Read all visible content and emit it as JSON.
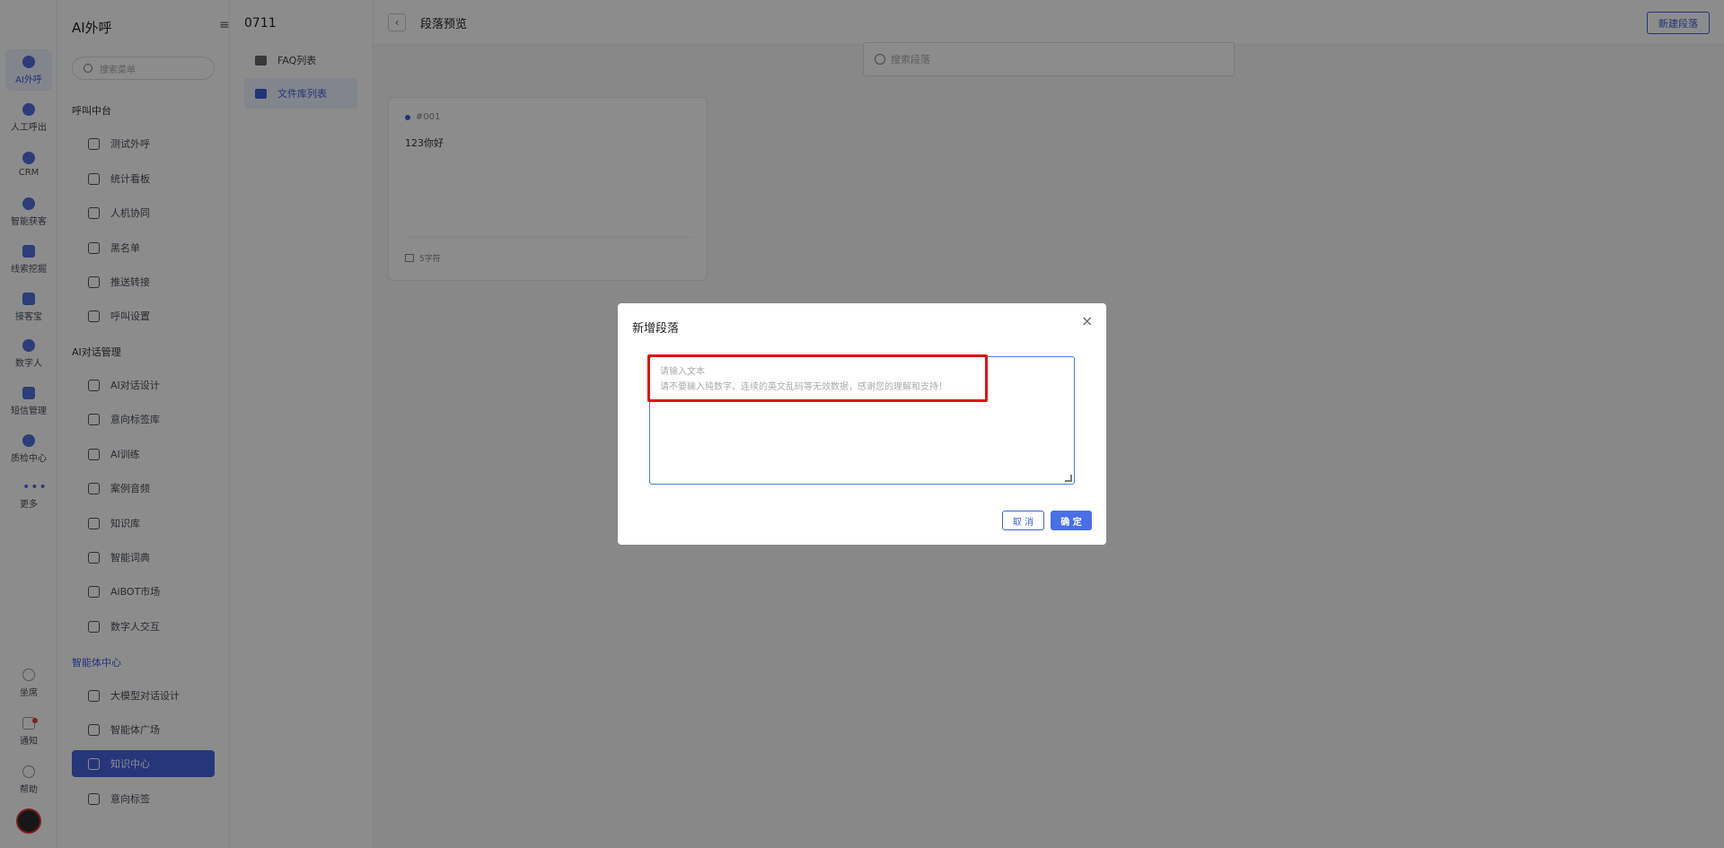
{
  "rail": {
    "items": [
      {
        "label": "AI外呼",
        "icon": "phone-ai-icon"
      },
      {
        "label": "人工呼出",
        "icon": "headset-icon"
      },
      {
        "label": "CRM",
        "icon": "crm-icon"
      },
      {
        "label": "智能获客",
        "icon": "acquire-icon"
      },
      {
        "label": "线索挖掘",
        "icon": "clue-icon"
      },
      {
        "label": "接客宝",
        "icon": "reception-icon"
      },
      {
        "label": "数字人",
        "icon": "digital-human-icon"
      },
      {
        "label": "短信管理",
        "icon": "sms-icon"
      },
      {
        "label": "质检中心",
        "icon": "quality-icon"
      },
      {
        "label": "更多",
        "icon": "more-icon"
      }
    ],
    "bottom": [
      {
        "label": "坐席",
        "icon": "seat-icon"
      },
      {
        "label": "通知",
        "icon": "bell-icon"
      },
      {
        "label": "帮助",
        "icon": "help-icon"
      }
    ]
  },
  "menu": {
    "title": "AI外呼",
    "collapse_icon": "≡",
    "search_placeholder": "搜索菜单",
    "groups": [
      {
        "label": "呼叫中台",
        "items": [
          "测试外呼",
          "统计看板",
          "人机协同",
          "黑名单",
          "推送转接",
          "呼叫设置"
        ]
      },
      {
        "label": "AI对话管理",
        "items": [
          "AI对话设计",
          "意向标签库",
          "AI训练",
          "案例音频",
          "知识库",
          "智能词典",
          "AiBOT市场",
          "数字人交互"
        ]
      },
      {
        "label": "智能体中心",
        "items": [
          "大模型对话设计",
          "智能体广场",
          "知识中心",
          "意向标签"
        ]
      }
    ]
  },
  "panel2": {
    "title": "0711",
    "items": [
      "FAQ列表",
      "文件库列表"
    ]
  },
  "main": {
    "back_icon": "‹",
    "title": "段落预览",
    "new_button": "新建段落",
    "search_placeholder": "搜索段落",
    "card": {
      "id": "#001",
      "text": "123你好",
      "chars": "5字符"
    }
  },
  "modal": {
    "title": "新增段落",
    "close_icon": "×",
    "placeholder_line1": "请输入文本",
    "placeholder_line2": "请不要输入纯数字、连续的英文乱码等无效数据，感谢您的理解和支持！",
    "cancel_label": "取 消",
    "ok_label": "确 定"
  },
  "colors": {
    "accent": "#3f5fd8",
    "highlight": "#e01212"
  }
}
